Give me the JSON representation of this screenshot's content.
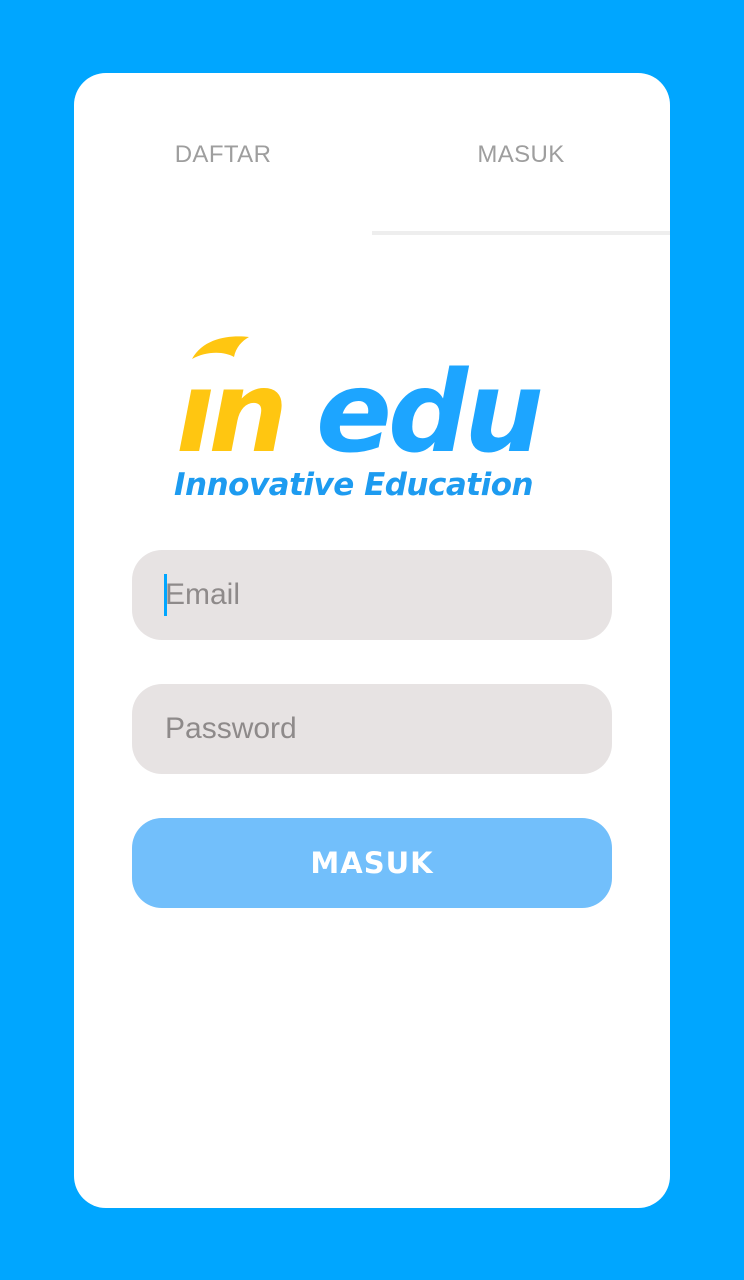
{
  "tabs": {
    "register_label": "DAFTAR",
    "login_label": "MASUK",
    "active": "MASUK"
  },
  "logo": {
    "brand": "inedu",
    "tagline": "Innovative Education"
  },
  "form": {
    "email_placeholder": "Email",
    "password_placeholder": "Password",
    "submit_label": "MASUK"
  },
  "colors": {
    "background": "#00A6FF",
    "card": "#FFFFFF",
    "logo_yellow": "#FFC611",
    "logo_blue": "#1DA5FF",
    "tagline_blue": "#1D9BF0",
    "field_bg": "#E7E3E3",
    "button_bg": "#72BFFB",
    "tab_text": "#9E9E9E"
  },
  "icons": {
    "text_caret": "text-caret-icon"
  }
}
